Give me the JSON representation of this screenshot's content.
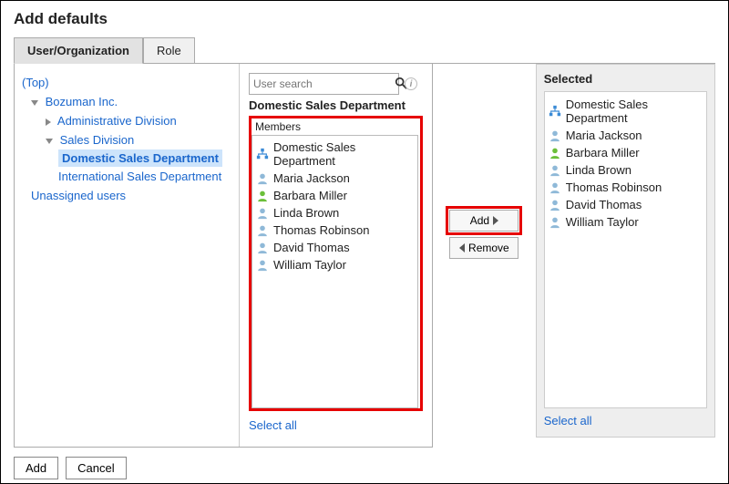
{
  "title": "Add defaults",
  "tabs": {
    "userorg": "User/Organization",
    "role": "Role"
  },
  "tree": {
    "top": "(Top)",
    "company": "Bozuman Inc.",
    "admin": "Administrative Division",
    "sales": "Sales Division",
    "domestic": "Domestic Sales Department",
    "international": "International Sales Department",
    "unassigned": "Unassigned users"
  },
  "search": {
    "placeholder": "User search"
  },
  "dept_title": "Domestic Sales Department",
  "members_label": "Members",
  "members": [
    {
      "type": "org",
      "name": "Domestic Sales Department"
    },
    {
      "type": "user",
      "name": "Maria Jackson"
    },
    {
      "type": "user_me",
      "name": "Barbara Miller"
    },
    {
      "type": "user",
      "name": "Linda Brown"
    },
    {
      "type": "user",
      "name": "Thomas Robinson"
    },
    {
      "type": "user",
      "name": "David Thomas"
    },
    {
      "type": "user",
      "name": "William Taylor"
    }
  ],
  "select_all": "Select all",
  "btn_add": "Add",
  "btn_remove": "Remove",
  "selected_title": "Selected",
  "selected": [
    {
      "type": "org",
      "name": "Domestic Sales Department"
    },
    {
      "type": "user",
      "name": "Maria Jackson"
    },
    {
      "type": "user_me",
      "name": "Barbara Miller"
    },
    {
      "type": "user",
      "name": "Linda Brown"
    },
    {
      "type": "user",
      "name": "Thomas Robinson"
    },
    {
      "type": "user",
      "name": "David Thomas"
    },
    {
      "type": "user",
      "name": "William Taylor"
    }
  ],
  "dlg_add": "Add",
  "dlg_cancel": "Cancel"
}
